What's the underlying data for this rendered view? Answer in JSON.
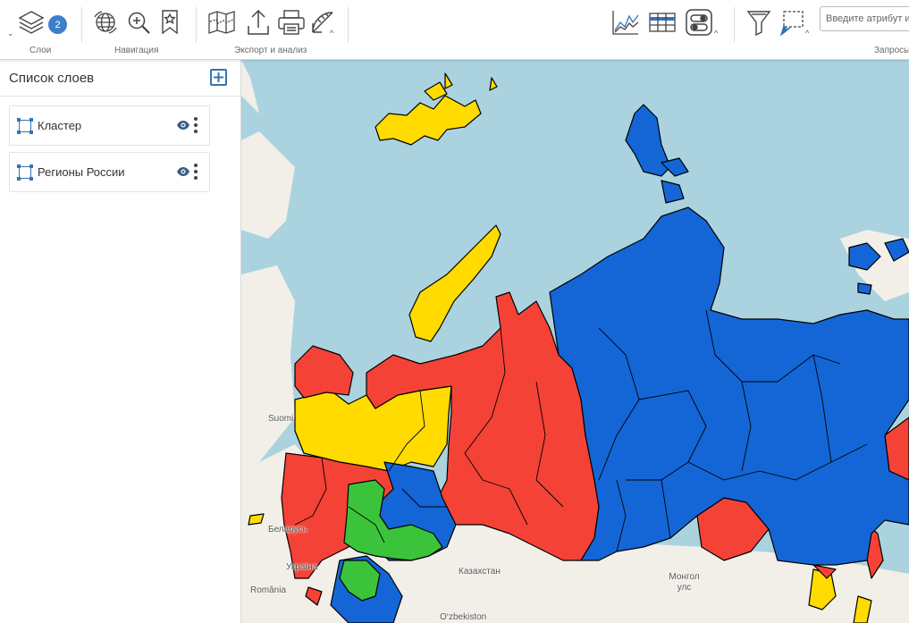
{
  "toolbar": {
    "layers_badge": "2",
    "groups": {
      "layers": "Слои",
      "navigation": "Навигация",
      "export": "Экспорт и анализ",
      "query": "Запросы"
    },
    "search_placeholder": "Введите атрибут и",
    "icons": [
      "layers-icon",
      "globe-icon",
      "zoom-in-icon",
      "bookmark-star-icon",
      "map-icon",
      "upload-icon",
      "print-icon",
      "measure-icon",
      "chart-icon",
      "table-icon",
      "toggle-panel-icon",
      "filter-icon",
      "select-area-icon"
    ]
  },
  "sidebar": {
    "title": "Список слоев",
    "layers": [
      {
        "name": "Кластер"
      },
      {
        "name": "Регионы России"
      }
    ]
  },
  "map": {
    "labels": {
      "suomi": "Suomi",
      "belarus": "Беларусь",
      "ukraine": "Україна",
      "romania": "România",
      "kazakhstan": "Казахстан",
      "mongolia": "Монгол улс",
      "uzbekistan": "O‘zbekiston"
    },
    "colors": {
      "water": "#aad3df",
      "land": "#f2efe9",
      "cluster_blue": "#1466d6",
      "cluster_red": "#f44336",
      "cluster_yellow": "#ffdb00",
      "cluster_green": "#3bc43b"
    }
  }
}
